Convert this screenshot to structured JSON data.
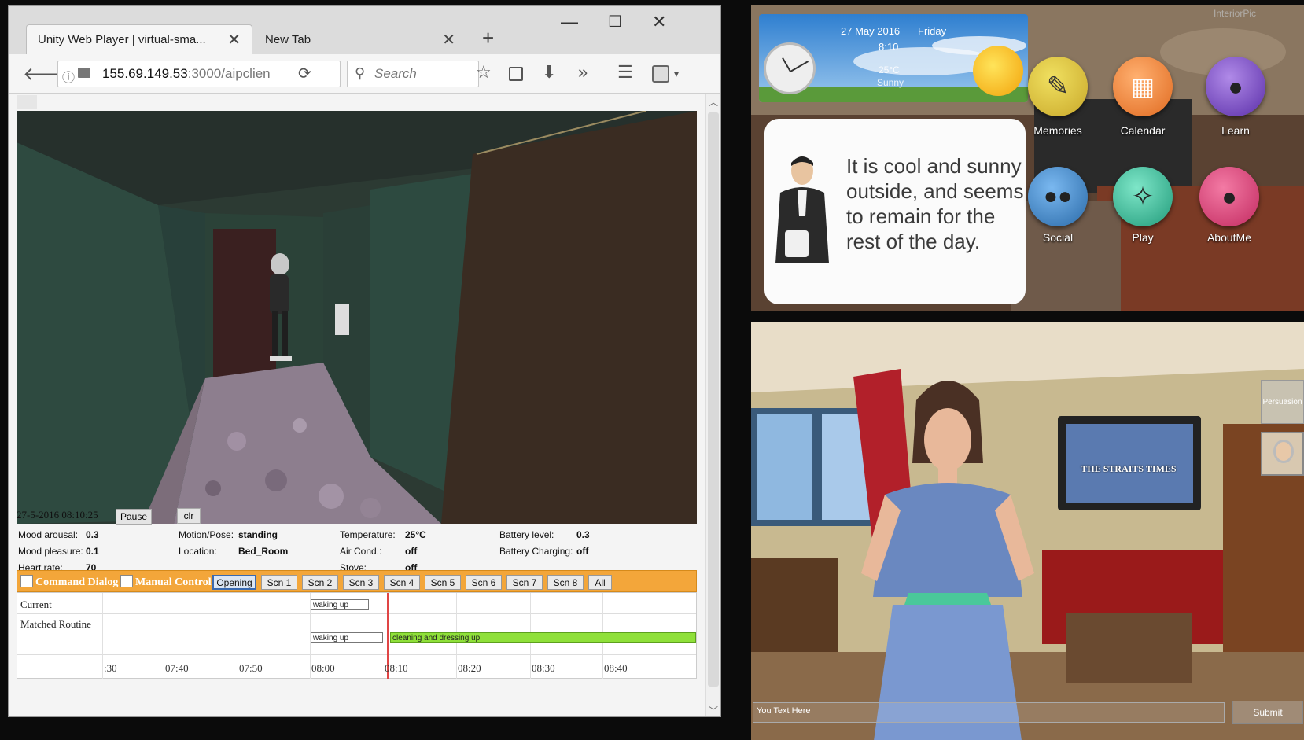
{
  "browser": {
    "active_tab_title": "Unity Web Player | virtual-sma...",
    "second_tab_title": "New Tab",
    "url_host": "155.69.149.53",
    "url_path": ":3000/aipclien",
    "search_placeholder": "Search"
  },
  "status": {
    "datetime": "27-5-2016 08:10:25",
    "pause_label": "Pause",
    "clr_label": "clr",
    "mood_arousal_label": "Mood arousal:",
    "mood_arousal_value": "0.3",
    "mood_pleasure_label": "Mood pleasure:",
    "mood_pleasure_value": "0.1",
    "heart_rate_label": "Heart rate:",
    "heart_rate_value": "70",
    "motion_label": "Motion/Pose:",
    "motion_value": "standing",
    "location_label": "Location:",
    "location_value": "Bed_Room",
    "temperature_label": "Temperature:",
    "temperature_value": "25°C",
    "aircond_label": "Air Cond.:",
    "aircond_value": "off",
    "stove_label": "Stove:",
    "stove_value": "off",
    "battery_level_label": "Battery level:",
    "battery_level_value": "0.3",
    "battery_charging_label": "Battery Charging:",
    "battery_charging_value": "off"
  },
  "controls": {
    "command_dialog": "Command Dialog",
    "manual_control": "Manual Control",
    "scenes": [
      "Opening",
      "Scn 1",
      "Scn 2",
      "Scn 3",
      "Scn 4",
      "Scn 5",
      "Scn 6",
      "Scn 7",
      "Scn 8",
      "All"
    ]
  },
  "timeline": {
    "current_label": "Current",
    "matched_label": "Matched Routine",
    "current_block": "waking up",
    "matched_block_1": "waking up",
    "matched_block_2": "cleaning and dressing up",
    "ticks": [
      ":30",
      "07:40",
      "07:50",
      "08:00",
      "08:10",
      "08:20",
      "08:30",
      "08:40"
    ]
  },
  "weather": {
    "date": "27 May 2016",
    "day": "Friday",
    "time": "8:10",
    "temperature": "25°C",
    "condition": "Sunny"
  },
  "speech": {
    "text": "It is cool and sunny outside, and seems to remain for the rest of the day."
  },
  "apps": [
    {
      "label": "Memories",
      "icon": "notebook-icon",
      "color": "#d8c33a"
    },
    {
      "label": "Calendar",
      "icon": "calendar-icon",
      "color": "#ef8a3c"
    },
    {
      "label": "Learn",
      "icon": "reader-icon",
      "color": "#7a4fc4"
    },
    {
      "label": "Social",
      "icon": "people-icon",
      "color": "#3f86c9"
    },
    {
      "label": "Play",
      "icon": "runner-icon",
      "color": "#3cb79a"
    },
    {
      "label": "AboutMe",
      "icon": "person-icon",
      "color": "#e0457a"
    }
  ],
  "tv_text": "THE STRAITS TIMES",
  "persuasion_label": "Persuasion",
  "input": {
    "placeholder": "You Text Here",
    "submit_label": "Submit"
  },
  "watermark": "InteriorPic"
}
